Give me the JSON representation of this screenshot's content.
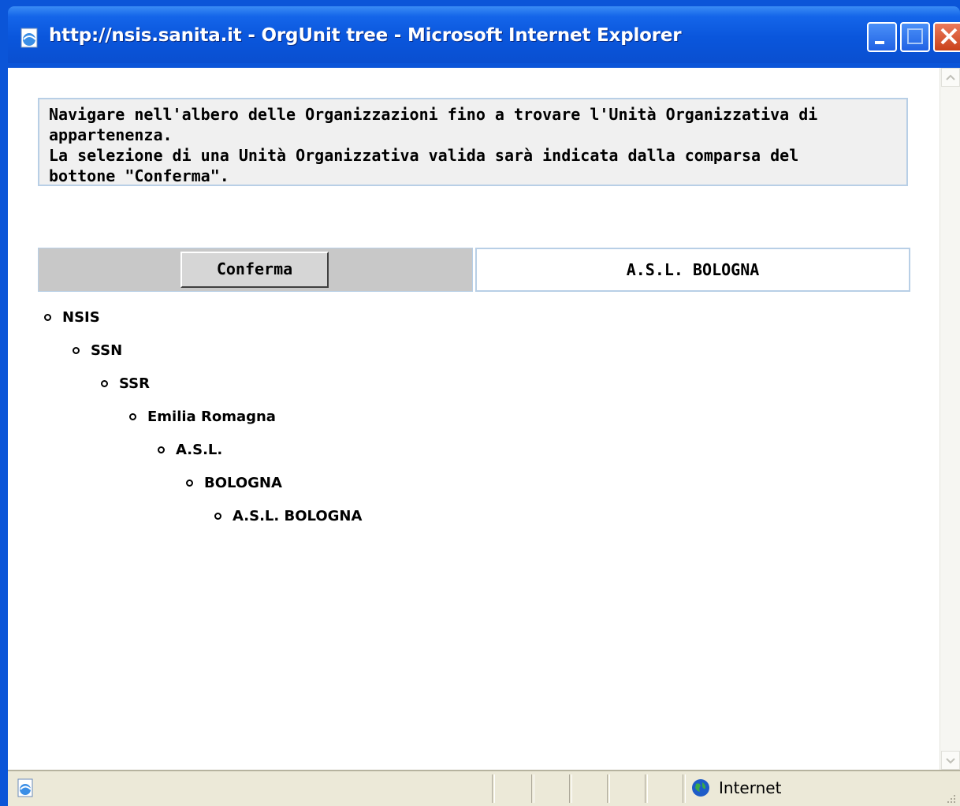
{
  "window": {
    "title": "http://nsis.sanita.it - OrgUnit tree - Microsoft Internet Explorer"
  },
  "instructions": {
    "lines": [
      "Navigare nell'albero delle Organizzazioni fino a trovare l'Unità Organizzativa di",
      "appartenenza.",
      "La selezione di una Unità Organizzativa valida sarà indicata dalla comparsa del",
      "bottone \"Conferma\"."
    ]
  },
  "actions": {
    "confirm_label": "Conferma",
    "selected_unit": "A.S.L. BOLOGNA"
  },
  "tree": [
    {
      "label": "NSIS",
      "level": 0
    },
    {
      "label": "SSN",
      "level": 1
    },
    {
      "label": "SSR",
      "level": 2
    },
    {
      "label": "Emilia Romagna",
      "level": 3
    },
    {
      "label": "A.S.L.",
      "level": 4
    },
    {
      "label": "BOLOGNA",
      "level": 5
    },
    {
      "label": "A.S.L. BOLOGNA",
      "level": 6
    }
  ],
  "statusbar": {
    "zone": "Internet"
  },
  "colors": {
    "titlebar": "#0b55d8",
    "panel_border": "#b8cfe6",
    "button_panel": "#c8c8c8"
  }
}
